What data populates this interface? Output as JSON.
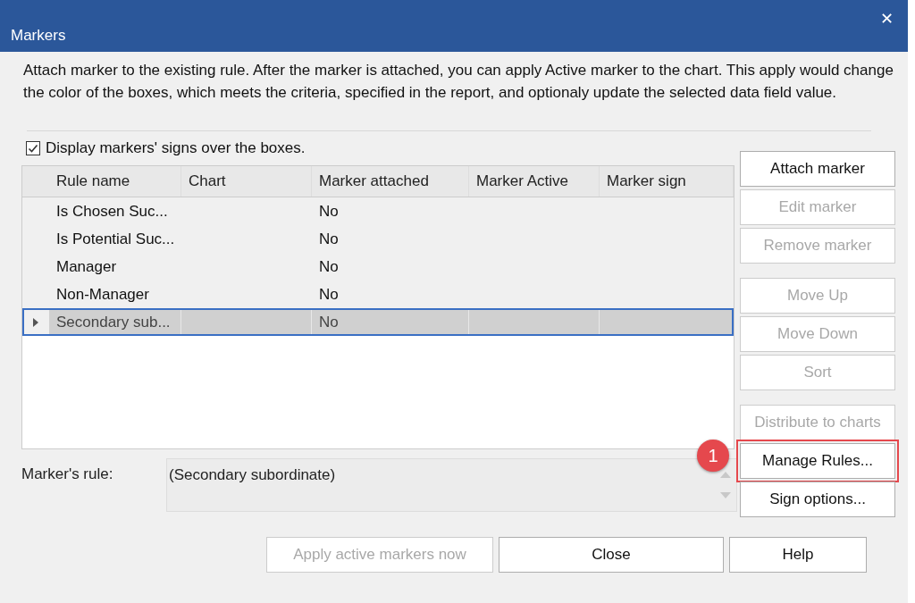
{
  "window": {
    "title": "Markers",
    "close_glyph": "✕"
  },
  "description": "Attach marker to the existing rule. After the marker is attached, you can apply Active marker to the chart. This apply would change the color of the boxes, which meets the criteria, specified in the report, and optionaly update the selected data field value.",
  "display_signs": {
    "label": "Display markers' signs over the boxes.",
    "checked": true
  },
  "table": {
    "columns": [
      "Rule name",
      "Chart",
      "Marker attached",
      "Marker Active",
      "Marker sign"
    ],
    "rows": [
      {
        "cells": [
          "Is Chosen Suc...",
          "",
          "No",
          "",
          ""
        ],
        "selected": false
      },
      {
        "cells": [
          "Is Potential Suc...",
          "",
          "No",
          "",
          ""
        ],
        "selected": false
      },
      {
        "cells": [
          "Manager",
          "",
          "No",
          "",
          ""
        ],
        "selected": false
      },
      {
        "cells": [
          "Non-Manager",
          "",
          "No",
          "",
          ""
        ],
        "selected": false
      },
      {
        "cells": [
          "Secondary sub...",
          "",
          "No",
          "",
          ""
        ],
        "selected": true
      }
    ]
  },
  "button_groups": [
    [
      {
        "label": "Attach marker",
        "disabled": false,
        "highlighted": false
      },
      {
        "label": "Edit marker",
        "disabled": true,
        "highlighted": false
      },
      {
        "label": "Remove  marker",
        "disabled": true,
        "highlighted": false
      }
    ],
    [
      {
        "label": "Move Up",
        "disabled": true,
        "highlighted": false
      },
      {
        "label": "Move Down",
        "disabled": true,
        "highlighted": false
      },
      {
        "label": "Sort",
        "disabled": true,
        "highlighted": false
      }
    ],
    [
      {
        "label": "Distribute to charts",
        "disabled": true,
        "highlighted": false
      },
      {
        "label": "Manage Rules...",
        "disabled": false,
        "highlighted": true,
        "callout": "1"
      },
      {
        "label": "Sign options...",
        "disabled": false,
        "highlighted": false
      }
    ]
  ],
  "markers_rule": {
    "label": "Marker's rule:",
    "value": "(Secondary subordinate)"
  },
  "footer_buttons": [
    {
      "label": "Apply active markers now",
      "disabled": true
    },
    {
      "label": "Close",
      "disabled": false
    },
    {
      "label": "Help",
      "disabled": false
    }
  ]
}
